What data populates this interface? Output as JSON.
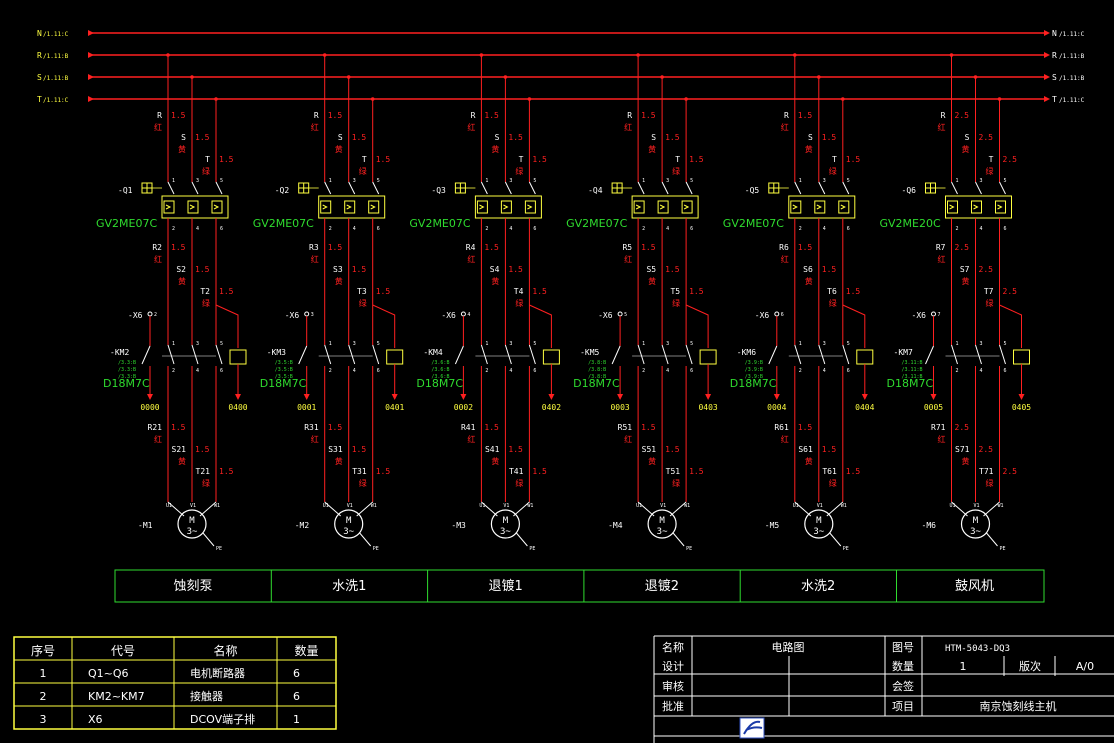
{
  "buses": [
    {
      "name": "N",
      "ref": "/1.11:C"
    },
    {
      "name": "R",
      "ref": "/1.11:B"
    },
    {
      "name": "S",
      "ref": "/1.11:B"
    },
    {
      "name": "T",
      "ref": "/1.11:C"
    }
  ],
  "branches": [
    {
      "breaker": "-Q1",
      "breaker_model": "GV2ME07C",
      "wire_size": "1.5",
      "wires_mid": [
        "R2",
        "S2",
        "T2"
      ],
      "terminal": "-X6",
      "terminal_no": "2",
      "contactor": "-KM2",
      "contactor_refs": [
        "/3.3:B",
        "/3.3:B",
        "/3.3:B"
      ],
      "contactor_model": "D18M7C",
      "out_left": "0000",
      "out_right": "0400",
      "wires_low": [
        "R21",
        "S21",
        "T21"
      ],
      "motor": "-M1",
      "load": "蚀刻泵"
    },
    {
      "breaker": "-Q2",
      "breaker_model": "GV2ME07C",
      "wire_size": "1.5",
      "wires_mid": [
        "R3",
        "S3",
        "T3"
      ],
      "terminal": "-X6",
      "terminal_no": "3",
      "contactor": "-KM3",
      "contactor_refs": [
        "/3.5:B",
        "/3.5:B",
        "/3.5:B"
      ],
      "contactor_model": "D18M7C",
      "out_left": "0001",
      "out_right": "0401",
      "wires_low": [
        "R31",
        "S31",
        "T31"
      ],
      "motor": "-M2",
      "load": "水洗1"
    },
    {
      "breaker": "-Q3",
      "breaker_model": "GV2ME07C",
      "wire_size": "1.5",
      "wires_mid": [
        "R4",
        "S4",
        "T4"
      ],
      "terminal": "-X6",
      "terminal_no": "4",
      "contactor": "-KM4",
      "contactor_refs": [
        "/3.6:B",
        "/3.6:B",
        "/3.6:B"
      ],
      "contactor_model": "D18M7C",
      "out_left": "0002",
      "out_right": "0402",
      "wires_low": [
        "R41",
        "S41",
        "T41"
      ],
      "motor": "-M3",
      "load": "退镀1"
    },
    {
      "breaker": "-Q4",
      "breaker_model": "GV2ME07C",
      "wire_size": "1.5",
      "wires_mid": [
        "R5",
        "S5",
        "T5"
      ],
      "terminal": "-X6",
      "terminal_no": "5",
      "contactor": "-KM5",
      "contactor_refs": [
        "/3.8:B",
        "/3.8:B",
        "/3.8:B"
      ],
      "contactor_model": "D18M7C",
      "out_left": "0003",
      "out_right": "0403",
      "wires_low": [
        "R51",
        "S51",
        "T51"
      ],
      "motor": "-M4",
      "load": "退镀2"
    },
    {
      "breaker": "-Q5",
      "breaker_model": "GV2ME07C",
      "wire_size": "1.5",
      "wires_mid": [
        "R6",
        "S6",
        "T6"
      ],
      "terminal": "-X6",
      "terminal_no": "6",
      "contactor": "-KM6",
      "contactor_refs": [
        "/3.9:B",
        "/3.9:B",
        "/3.9:B"
      ],
      "contactor_model": "D18M7C",
      "out_left": "0004",
      "out_right": "0404",
      "wires_low": [
        "R61",
        "S61",
        "T61"
      ],
      "motor": "-M5",
      "load": "水洗2"
    },
    {
      "breaker": "-Q6",
      "breaker_model": "GV2ME20C",
      "wire_size": "2.5",
      "wires_mid": [
        "R7",
        "S7",
        "T7"
      ],
      "terminal": "-X6",
      "terminal_no": "7",
      "contactor": "-KM7",
      "contactor_refs": [
        "/3.11:B",
        "/3.11:B",
        "/3.11:B"
      ],
      "contactor_model": "D18M7C",
      "out_left": "0005",
      "out_right": "0405",
      "wires_low": [
        "R71",
        "S71",
        "T71"
      ],
      "motor": "-M6",
      "load": "鼓风机"
    }
  ],
  "top_wire_labels": [
    "R",
    "S",
    "T"
  ],
  "color_labels": [
    "红",
    "黄",
    "绿"
  ],
  "terminal_labels": [
    "U1",
    "V1",
    "W1",
    "PE"
  ],
  "motor_symbol": [
    "M",
    "3~"
  ],
  "contact_nums": [
    "1",
    "3",
    "5",
    "2",
    "4",
    "6"
  ],
  "parts_table": {
    "headers": [
      "序号",
      "代号",
      "名称",
      "数量"
    ],
    "rows": [
      [
        "1",
        "Q1~Q6",
        "电机断路器",
        "6"
      ],
      [
        "2",
        "KM2~KM7",
        "接触器",
        "6"
      ],
      [
        "3",
        "X6",
        "DCOV端子排",
        "1"
      ]
    ]
  },
  "title_block": {
    "name_label": "名称",
    "name": "电路图",
    "drawing_no_label": "图号",
    "drawing_no": "HTM-5043-DQ3",
    "design_label": "设计",
    "quantity_label": "数量",
    "quantity": "1",
    "version_label": "版次",
    "version": "A/0",
    "review_label": "审核",
    "countersign_label": "会签",
    "approve_label": "批准",
    "project_label": "项目",
    "project": "南京蚀刻线主机"
  },
  "colors": {
    "background": "#000000",
    "power": "#ff2020",
    "device": "#ffff40",
    "text_green": "#2fdc2f",
    "line_white": "#ffffff",
    "label_text": "#ffffff"
  }
}
